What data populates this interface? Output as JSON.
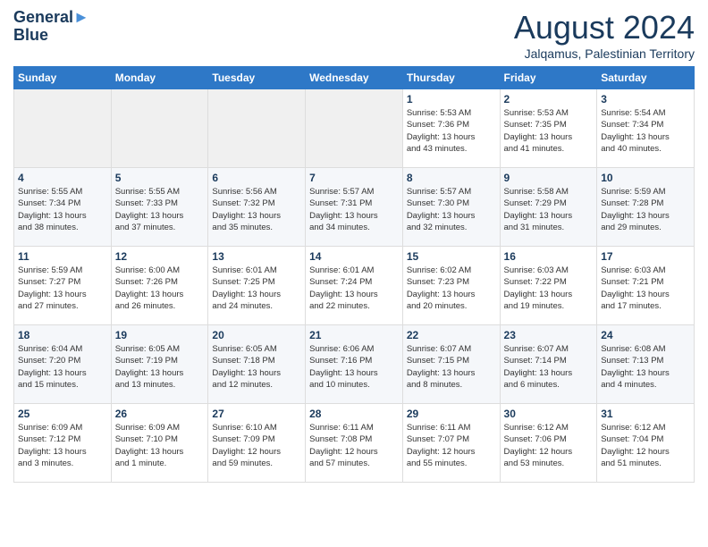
{
  "header": {
    "logo_line1": "General",
    "logo_line2": "Blue",
    "month": "August 2024",
    "location": "Jalqamus, Palestinian Territory"
  },
  "weekdays": [
    "Sunday",
    "Monday",
    "Tuesday",
    "Wednesday",
    "Thursday",
    "Friday",
    "Saturday"
  ],
  "weeks": [
    [
      {
        "day": "",
        "content": ""
      },
      {
        "day": "",
        "content": ""
      },
      {
        "day": "",
        "content": ""
      },
      {
        "day": "",
        "content": ""
      },
      {
        "day": "1",
        "content": "Sunrise: 5:53 AM\nSunset: 7:36 PM\nDaylight: 13 hours\nand 43 minutes."
      },
      {
        "day": "2",
        "content": "Sunrise: 5:53 AM\nSunset: 7:35 PM\nDaylight: 13 hours\nand 41 minutes."
      },
      {
        "day": "3",
        "content": "Sunrise: 5:54 AM\nSunset: 7:34 PM\nDaylight: 13 hours\nand 40 minutes."
      }
    ],
    [
      {
        "day": "4",
        "content": "Sunrise: 5:55 AM\nSunset: 7:34 PM\nDaylight: 13 hours\nand 38 minutes."
      },
      {
        "day": "5",
        "content": "Sunrise: 5:55 AM\nSunset: 7:33 PM\nDaylight: 13 hours\nand 37 minutes."
      },
      {
        "day": "6",
        "content": "Sunrise: 5:56 AM\nSunset: 7:32 PM\nDaylight: 13 hours\nand 35 minutes."
      },
      {
        "day": "7",
        "content": "Sunrise: 5:57 AM\nSunset: 7:31 PM\nDaylight: 13 hours\nand 34 minutes."
      },
      {
        "day": "8",
        "content": "Sunrise: 5:57 AM\nSunset: 7:30 PM\nDaylight: 13 hours\nand 32 minutes."
      },
      {
        "day": "9",
        "content": "Sunrise: 5:58 AM\nSunset: 7:29 PM\nDaylight: 13 hours\nand 31 minutes."
      },
      {
        "day": "10",
        "content": "Sunrise: 5:59 AM\nSunset: 7:28 PM\nDaylight: 13 hours\nand 29 minutes."
      }
    ],
    [
      {
        "day": "11",
        "content": "Sunrise: 5:59 AM\nSunset: 7:27 PM\nDaylight: 13 hours\nand 27 minutes."
      },
      {
        "day": "12",
        "content": "Sunrise: 6:00 AM\nSunset: 7:26 PM\nDaylight: 13 hours\nand 26 minutes."
      },
      {
        "day": "13",
        "content": "Sunrise: 6:01 AM\nSunset: 7:25 PM\nDaylight: 13 hours\nand 24 minutes."
      },
      {
        "day": "14",
        "content": "Sunrise: 6:01 AM\nSunset: 7:24 PM\nDaylight: 13 hours\nand 22 minutes."
      },
      {
        "day": "15",
        "content": "Sunrise: 6:02 AM\nSunset: 7:23 PM\nDaylight: 13 hours\nand 20 minutes."
      },
      {
        "day": "16",
        "content": "Sunrise: 6:03 AM\nSunset: 7:22 PM\nDaylight: 13 hours\nand 19 minutes."
      },
      {
        "day": "17",
        "content": "Sunrise: 6:03 AM\nSunset: 7:21 PM\nDaylight: 13 hours\nand 17 minutes."
      }
    ],
    [
      {
        "day": "18",
        "content": "Sunrise: 6:04 AM\nSunset: 7:20 PM\nDaylight: 13 hours\nand 15 minutes."
      },
      {
        "day": "19",
        "content": "Sunrise: 6:05 AM\nSunset: 7:19 PM\nDaylight: 13 hours\nand 13 minutes."
      },
      {
        "day": "20",
        "content": "Sunrise: 6:05 AM\nSunset: 7:18 PM\nDaylight: 13 hours\nand 12 minutes."
      },
      {
        "day": "21",
        "content": "Sunrise: 6:06 AM\nSunset: 7:16 PM\nDaylight: 13 hours\nand 10 minutes."
      },
      {
        "day": "22",
        "content": "Sunrise: 6:07 AM\nSunset: 7:15 PM\nDaylight: 13 hours\nand 8 minutes."
      },
      {
        "day": "23",
        "content": "Sunrise: 6:07 AM\nSunset: 7:14 PM\nDaylight: 13 hours\nand 6 minutes."
      },
      {
        "day": "24",
        "content": "Sunrise: 6:08 AM\nSunset: 7:13 PM\nDaylight: 13 hours\nand 4 minutes."
      }
    ],
    [
      {
        "day": "25",
        "content": "Sunrise: 6:09 AM\nSunset: 7:12 PM\nDaylight: 13 hours\nand 3 minutes."
      },
      {
        "day": "26",
        "content": "Sunrise: 6:09 AM\nSunset: 7:10 PM\nDaylight: 13 hours\nand 1 minute."
      },
      {
        "day": "27",
        "content": "Sunrise: 6:10 AM\nSunset: 7:09 PM\nDaylight: 12 hours\nand 59 minutes."
      },
      {
        "day": "28",
        "content": "Sunrise: 6:11 AM\nSunset: 7:08 PM\nDaylight: 12 hours\nand 57 minutes."
      },
      {
        "day": "29",
        "content": "Sunrise: 6:11 AM\nSunset: 7:07 PM\nDaylight: 12 hours\nand 55 minutes."
      },
      {
        "day": "30",
        "content": "Sunrise: 6:12 AM\nSunset: 7:06 PM\nDaylight: 12 hours\nand 53 minutes."
      },
      {
        "day": "31",
        "content": "Sunrise: 6:12 AM\nSunset: 7:04 PM\nDaylight: 12 hours\nand 51 minutes."
      }
    ]
  ]
}
